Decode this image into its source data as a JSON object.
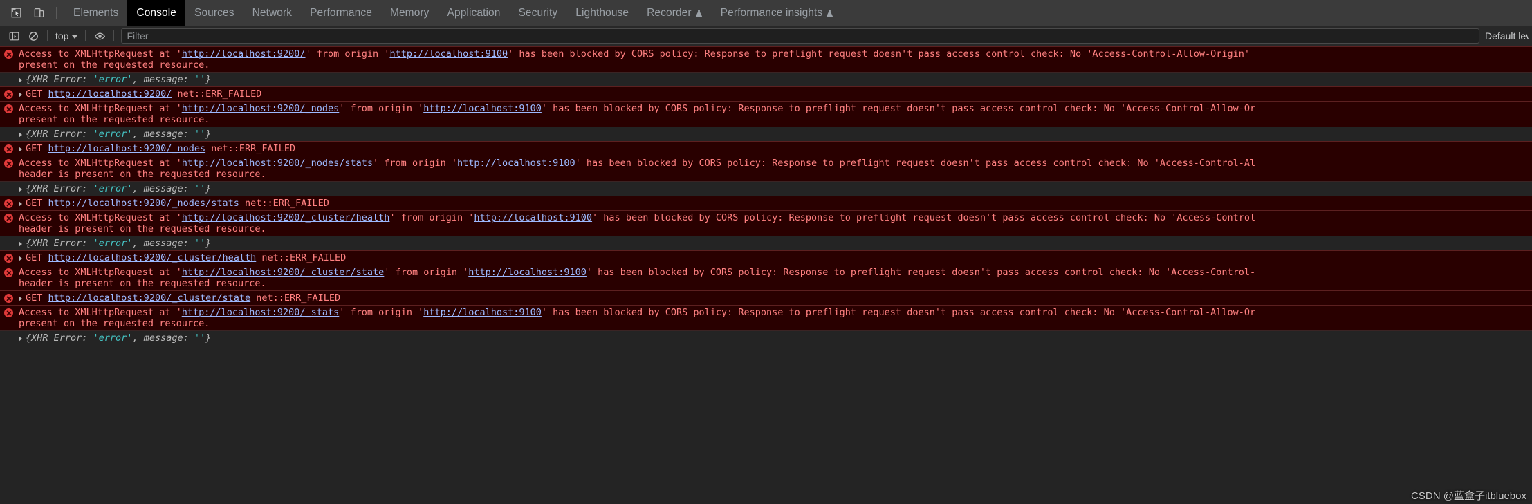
{
  "window": {
    "theme_bg": "#282828",
    "error_bg": "#290000",
    "error_text_color": "#ff8080",
    "link_color": "#9db9ff",
    "accent": "#1a73e8"
  },
  "toolbar": {
    "icons": [
      {
        "name": "inspect-element-icon",
        "glyph": "cursor-box"
      },
      {
        "name": "device-toolbar-icon",
        "glyph": "device"
      }
    ],
    "tabs": [
      {
        "label": "Elements",
        "active": false,
        "experimental": false
      },
      {
        "label": "Console",
        "active": true,
        "experimental": false
      },
      {
        "label": "Sources",
        "active": false,
        "experimental": false
      },
      {
        "label": "Network",
        "active": false,
        "experimental": false
      },
      {
        "label": "Performance",
        "active": false,
        "experimental": false
      },
      {
        "label": "Memory",
        "active": false,
        "experimental": false
      },
      {
        "label": "Application",
        "active": false,
        "experimental": false
      },
      {
        "label": "Security",
        "active": false,
        "experimental": false
      },
      {
        "label": "Lighthouse",
        "active": false,
        "experimental": false
      },
      {
        "label": "Recorder",
        "active": false,
        "experimental": true
      },
      {
        "label": "Performance insights",
        "active": false,
        "experimental": true
      }
    ]
  },
  "filterbar": {
    "sidebar_toggle_icon": "console-sidebar-icon",
    "clear_console_icon": "clear-console-icon",
    "context_selector": "top",
    "eye_icon": "live-expression-eye-icon",
    "filter_placeholder": "Filter",
    "filter_value": "",
    "level_selector": "Default lev"
  },
  "console_rows": [
    {
      "type": "error",
      "segments": [
        {
          "t": "Access to XMLHttpRequest at '",
          "k": "text"
        },
        {
          "t": "http://localhost:9200/",
          "k": "link"
        },
        {
          "t": "' from origin '",
          "k": "text"
        },
        {
          "t": "http://localhost:9100",
          "k": "link"
        },
        {
          "t": "' has been blocked by CORS policy: Response to preflight request doesn't pass access control check: No 'Access-Control-Allow-Origin'",
          "k": "text"
        }
      ],
      "continuation": "present on the requested resource."
    },
    {
      "type": "xhr",
      "text_pre": "{XHR Error: ",
      "str1": "'error'",
      "text_mid": ", message: ",
      "str2": "''",
      "text_post": "}"
    },
    {
      "type": "error",
      "arrow": true,
      "segments": [
        {
          "t": "GET ",
          "k": "text"
        },
        {
          "t": "http://localhost:9200/",
          "k": "link"
        },
        {
          "t": " net::ERR_FAILED",
          "k": "text"
        }
      ]
    },
    {
      "type": "error",
      "segments": [
        {
          "t": "Access to XMLHttpRequest at '",
          "k": "text"
        },
        {
          "t": "http://localhost:9200/_nodes",
          "k": "link"
        },
        {
          "t": "' from origin '",
          "k": "text"
        },
        {
          "t": "http://localhost:9100",
          "k": "link"
        },
        {
          "t": "' has been blocked by CORS policy: Response to preflight request doesn't pass access control check: No 'Access-Control-Allow-Or",
          "k": "text"
        }
      ],
      "continuation": "present on the requested resource."
    },
    {
      "type": "xhr",
      "text_pre": "{XHR Error: ",
      "str1": "'error'",
      "text_mid": ", message: ",
      "str2": "''",
      "text_post": "}"
    },
    {
      "type": "error",
      "arrow": true,
      "segments": [
        {
          "t": "GET ",
          "k": "text"
        },
        {
          "t": "http://localhost:9200/_nodes",
          "k": "link"
        },
        {
          "t": " net::ERR_FAILED",
          "k": "text"
        }
      ]
    },
    {
      "type": "error",
      "segments": [
        {
          "t": "Access to XMLHttpRequest at '",
          "k": "text"
        },
        {
          "t": "http://localhost:9200/_nodes/stats",
          "k": "link"
        },
        {
          "t": "' from origin '",
          "k": "text"
        },
        {
          "t": "http://localhost:9100",
          "k": "link"
        },
        {
          "t": "' has been blocked by CORS policy: Response to preflight request doesn't pass access control check: No 'Access-Control-Al",
          "k": "text"
        }
      ],
      "continuation": "header is present on the requested resource."
    },
    {
      "type": "xhr",
      "text_pre": "{XHR Error: ",
      "str1": "'error'",
      "text_mid": ", message: ",
      "str2": "''",
      "text_post": "}"
    },
    {
      "type": "error",
      "arrow": true,
      "segments": [
        {
          "t": "GET ",
          "k": "text"
        },
        {
          "t": "http://localhost:9200/_nodes/stats",
          "k": "link"
        },
        {
          "t": " net::ERR_FAILED",
          "k": "text"
        }
      ]
    },
    {
      "type": "error",
      "segments": [
        {
          "t": "Access to XMLHttpRequest at '",
          "k": "text"
        },
        {
          "t": "http://localhost:9200/_cluster/health",
          "k": "link"
        },
        {
          "t": "' from origin '",
          "k": "text"
        },
        {
          "t": "http://localhost:9100",
          "k": "link"
        },
        {
          "t": "' has been blocked by CORS policy: Response to preflight request doesn't pass access control check: No 'Access-Control",
          "k": "text"
        }
      ],
      "continuation": "header is present on the requested resource."
    },
    {
      "type": "xhr",
      "text_pre": "{XHR Error: ",
      "str1": "'error'",
      "text_mid": ", message: ",
      "str2": "''",
      "text_post": "}"
    },
    {
      "type": "error",
      "arrow": true,
      "segments": [
        {
          "t": "GET ",
          "k": "text"
        },
        {
          "t": "http://localhost:9200/_cluster/health",
          "k": "link"
        },
        {
          "t": " net::ERR_FAILED",
          "k": "text"
        }
      ]
    },
    {
      "type": "error",
      "segments": [
        {
          "t": "Access to XMLHttpRequest at '",
          "k": "text"
        },
        {
          "t": "http://localhost:9200/_cluster/state",
          "k": "link"
        },
        {
          "t": "' from origin '",
          "k": "text"
        },
        {
          "t": "http://localhost:9100",
          "k": "link"
        },
        {
          "t": "' has been blocked by CORS policy: Response to preflight request doesn't pass access control check: No 'Access-Control-",
          "k": "text"
        }
      ],
      "continuation": "header is present on the requested resource."
    },
    {
      "type": "error",
      "arrow": true,
      "segments": [
        {
          "t": "GET ",
          "k": "text"
        },
        {
          "t": "http://localhost:9200/_cluster/state",
          "k": "link"
        },
        {
          "t": " net::ERR_FAILED",
          "k": "text"
        }
      ]
    },
    {
      "type": "error",
      "segments": [
        {
          "t": "Access to XMLHttpRequest at '",
          "k": "text"
        },
        {
          "t": "http://localhost:9200/_stats",
          "k": "link"
        },
        {
          "t": "' from origin '",
          "k": "text"
        },
        {
          "t": "http://localhost:9100",
          "k": "link"
        },
        {
          "t": "' has been blocked by CORS policy: Response to preflight request doesn't pass access control check: No 'Access-Control-Allow-Or",
          "k": "text"
        }
      ],
      "continuation": "present on the requested resource."
    },
    {
      "type": "xhr",
      "text_pre": "{XHR Error: ",
      "str1": "'error'",
      "text_mid": ", message: ",
      "str2": "''",
      "text_post": "}"
    }
  ],
  "watermark": "CSDN @蓝盒子itbluebox"
}
